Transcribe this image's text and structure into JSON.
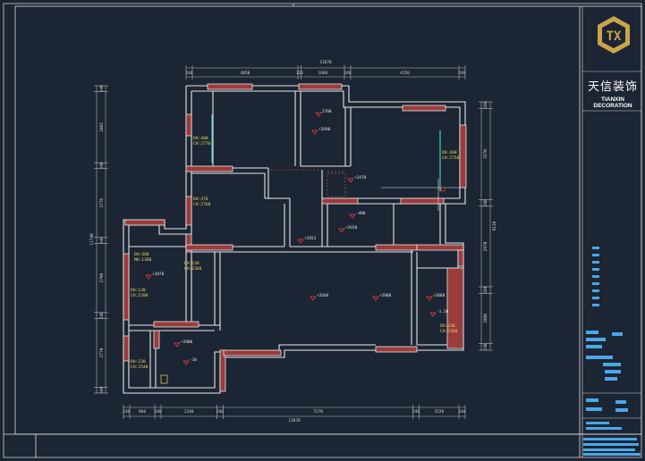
{
  "brand": {
    "name_cn": "天信装饰",
    "name_en": "TIANXIN DECORATION",
    "logo_letters": "TX",
    "logo_color": "#c9a44a"
  },
  "colors": {
    "background": "#1c2533",
    "frame": "#e0e0e0",
    "wall": "#e8e8e8",
    "window_fill": "#9b3c3c",
    "dim_line": "#b8b8b8",
    "annotation": "#e8d85a",
    "marker": "#ff3b3b",
    "accent_line": "#3fd0c0",
    "title_block_text": "#4aa8e8"
  },
  "dimensions": {
    "top_total": "13870",
    "top_segments": [
      "240",
      "4050",
      "120",
      "1660",
      "240",
      "4150",
      "240"
    ],
    "bottom_total": "13870",
    "bottom_segments": [
      "240",
      "960",
      "240",
      "2140",
      "240",
      "7270",
      "240",
      "1520",
      "240"
    ],
    "left_total": "11740",
    "left_segments": [
      "240",
      "2865",
      "240",
      "2776",
      "240",
      "2790",
      "240",
      "2770",
      "240"
    ],
    "right_total": "9110",
    "right_segments": [
      "240",
      "3370",
      "240",
      "2970",
      "240",
      "1860",
      "240"
    ]
  },
  "annotations": [
    {
      "id": "dh400-ch2770",
      "line1": "DH:400",
      "line2": "CH:2770"
    },
    {
      "id": "dh400-ch2750",
      "line1": "DH:400",
      "line2": "CH:2750"
    },
    {
      "id": "dh470-ch2760",
      "line1": "DH:470",
      "line2": "CH:2760"
    },
    {
      "id": "dh480-mh1380",
      "line1": "DH:480",
      "line2": "MH:1380"
    },
    {
      "id": "dh230-ch2360",
      "line1": "DH:230",
      "line2": "CH:2360"
    },
    {
      "id": "dh130-ch2280",
      "line1": "DH:130",
      "line2": "CH:2280"
    },
    {
      "id": "dh230-ch2540",
      "line1": "DH:230",
      "line2": "CH:2540"
    },
    {
      "id": "dh230-ch2340",
      "line1": "DH:230",
      "line2": "CH:2340"
    }
  ],
  "levels": [
    "2700",
    "+2690",
    "+2470",
    "+2453",
    "+2650",
    "-400",
    "+2870",
    "+2640",
    "+2880",
    "+2900",
    "-1.20",
    "+2800",
    "-10"
  ]
}
